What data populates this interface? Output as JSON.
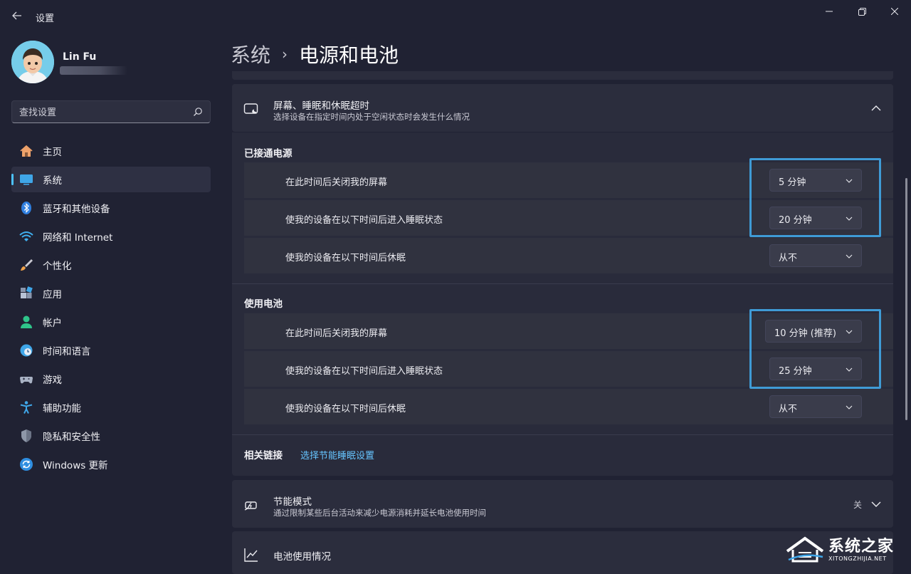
{
  "window": {
    "title": "设置",
    "controls": [
      "minimize",
      "maximize",
      "close"
    ]
  },
  "user": {
    "name": "Lin Fu"
  },
  "search": {
    "placeholder": "查找设置"
  },
  "sidebar": {
    "items": [
      {
        "label": "主页",
        "icon": "home-icon"
      },
      {
        "label": "系统",
        "icon": "system-icon",
        "active": true
      },
      {
        "label": "蓝牙和其他设备",
        "icon": "bluetooth-icon"
      },
      {
        "label": "网络和 Internet",
        "icon": "wifi-icon"
      },
      {
        "label": "个性化",
        "icon": "brush-icon"
      },
      {
        "label": "应用",
        "icon": "apps-icon"
      },
      {
        "label": "帐户",
        "icon": "account-icon"
      },
      {
        "label": "时间和语言",
        "icon": "globe-clock-icon"
      },
      {
        "label": "游戏",
        "icon": "gamepad-icon"
      },
      {
        "label": "辅助功能",
        "icon": "accessibility-icon"
      },
      {
        "label": "隐私和安全性",
        "icon": "shield-icon"
      },
      {
        "label": "Windows 更新",
        "icon": "update-icon"
      }
    ],
    "accent_color": "#4cc2ff"
  },
  "breadcrumb": {
    "parent": "系统",
    "separator": "›",
    "current": "电源和电池"
  },
  "screen_sleep": {
    "title": "屏幕、睡眠和休眠超时",
    "description": "选择设备在指定时间内处于空闲状态时会发生什么情况",
    "expanded": true,
    "plugged_in": {
      "label": "已接通电源",
      "rows": [
        {
          "label": "在此时间后关闭我的屏幕",
          "value": "5 分钟"
        },
        {
          "label": "使我的设备在以下时间后进入睡眠状态",
          "value": "20 分钟"
        },
        {
          "label": "使我的设备在以下时间后休眠",
          "value": "从不"
        }
      ]
    },
    "on_battery": {
      "label": "使用电池",
      "rows": [
        {
          "label": "在此时间后关闭我的屏幕",
          "value": "10 分钟 (推荐)"
        },
        {
          "label": "使我的设备在以下时间后进入睡眠状态",
          "value": "25 分钟"
        },
        {
          "label": "使我的设备在以下时间后休眠",
          "value": "从不"
        }
      ]
    },
    "related": {
      "label": "相关链接",
      "link": "选择节能睡眠设置"
    }
  },
  "energy_saver": {
    "title": "节能模式",
    "description": "通过限制某些后台活动来减少电源消耗并延长电池使用时间",
    "state": "关"
  },
  "battery_usage": {
    "title": "电池使用情况"
  },
  "watermark": {
    "name": "系统之家",
    "url": "XITONGZHIJIA.NET"
  },
  "colors": {
    "background": "#202233",
    "card": "#2b2d3d",
    "highlight_box": "#3f9bd6",
    "link": "#66c5ff"
  }
}
